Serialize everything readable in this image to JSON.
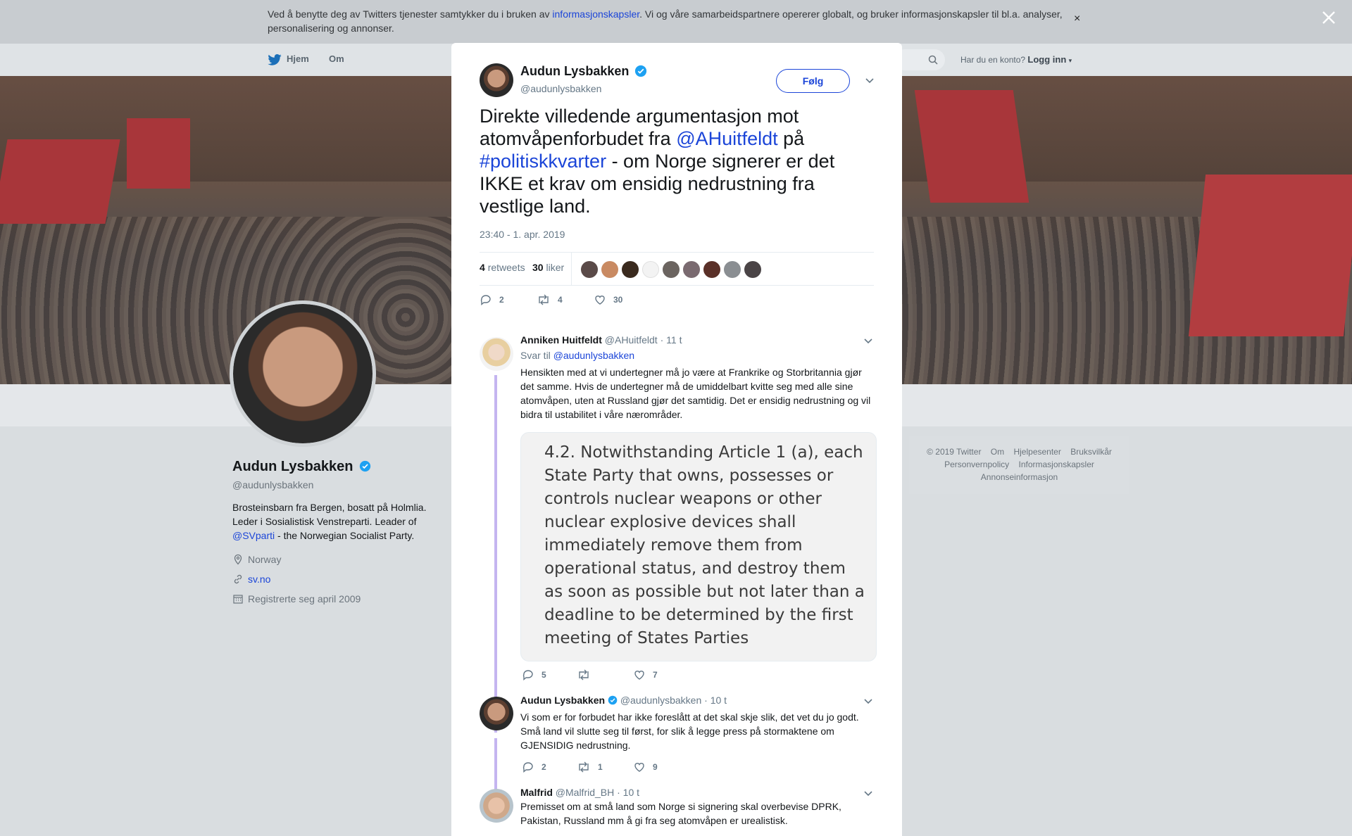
{
  "cookie_banner": {
    "text_before": "Ved å benytte deg av Twitters tjenester samtykker du i bruken av ",
    "link": "informasjonskapsler",
    "text_after": ". Vi og våre samarbeidspartnere opererer globalt, og bruker informasjonskapsler til bl.a. analyser, personalisering og annonser.",
    "close": "×"
  },
  "topnav": {
    "home": "Hjem",
    "about": "Om",
    "account_question": "Har du en konto?",
    "login": "Logg inn"
  },
  "profile": {
    "name": "Audun Lysbakken",
    "handle": "@audunlysbakken",
    "bio_before": "Brosteinsbarn fra Bergen, bosatt på Holmlia. Leder i Sosialistisk Venstreparti. Leader of ",
    "bio_link": "@SVparti",
    "bio_after": " - the Norwegian Socialist Party.",
    "location": "Norway",
    "website": "sv.no",
    "joined": "Registrerte seg april 2009"
  },
  "footer": {
    "items": [
      "© 2019 Twitter",
      "Om",
      "Hjelpesenter",
      "Bruksvilkår",
      "Personvernpolicy",
      "Informasjonskapsler",
      "Annonseinformasjon"
    ]
  },
  "tweet": {
    "author_name": "Audun Lysbakken",
    "author_handle": "@audunlysbakken",
    "follow_label": "Følg",
    "text_1": "Direkte villedende argumentasjon mot atomvåpenforbudet fra ",
    "mention": "@AHuitfeldt",
    "text_2": " på ",
    "hashtag": "#politiskkvarter",
    "text_3": " - om Norge signerer er det IKKE et krav om ensidig nedrustning fra vestlige land.",
    "timestamp": "23:40 - 1. apr. 2019",
    "retweets_count": "4",
    "retweets_label": "retweets",
    "likes_count": "30",
    "likes_label": "liker",
    "reply_count": "2",
    "retweet_count_action": "4",
    "like_count_action": "30"
  },
  "replies": [
    {
      "name": "Anniken Huitfeldt",
      "handle": "@AHuitfeldt",
      "time": "· 11 t",
      "reply_to_label": "Svar til ",
      "reply_to": "@audunlysbakken",
      "text": "Hensikten med at vi undertegner må jo være at Frankrike og Storbritannia gjør det samme. Hvis de undertegner må de umiddelbart kvitte seg med alle sine atomvåpen, uten at Russland gjør det samtidig. Det er ensidig nedrustning og vil bidra til ustabilitet i våre nærområder.",
      "media_text": "4.2. Notwithstanding Article 1 (a), each State Party that owns, possesses or controls nuclear weapons or other nuclear explosive devices shall immediately remove them from operational status, and destroy them as soon as possible but not later than a deadline to be determined by the first meeting of States Parties",
      "replies": "5",
      "retweets": "",
      "likes": "7"
    },
    {
      "name": "Audun Lysbakken",
      "handle": "@audunlysbakken",
      "time": "· 10 t",
      "text": "Vi som er for forbudet har ikke foreslått at det skal skje slik, det vet du jo godt. Små land vil slutte seg til først, for slik å legge press på stormaktene om GJENSIDIG nedrustning.",
      "replies": "2",
      "retweets": "1",
      "likes": "9"
    },
    {
      "name": "Malfrid",
      "handle": "@Malfrid_BH",
      "time": "· 10 t",
      "text": "Premisset om at små land som Norge si signering skal overbevise DPRK, Pakistan, Russland mm å gi fra seg atomvåpen er urealistisk."
    }
  ],
  "colors": {
    "link": "#1b45d8",
    "verified": "#1da1f2",
    "thread_line": "#c4b5f0"
  }
}
